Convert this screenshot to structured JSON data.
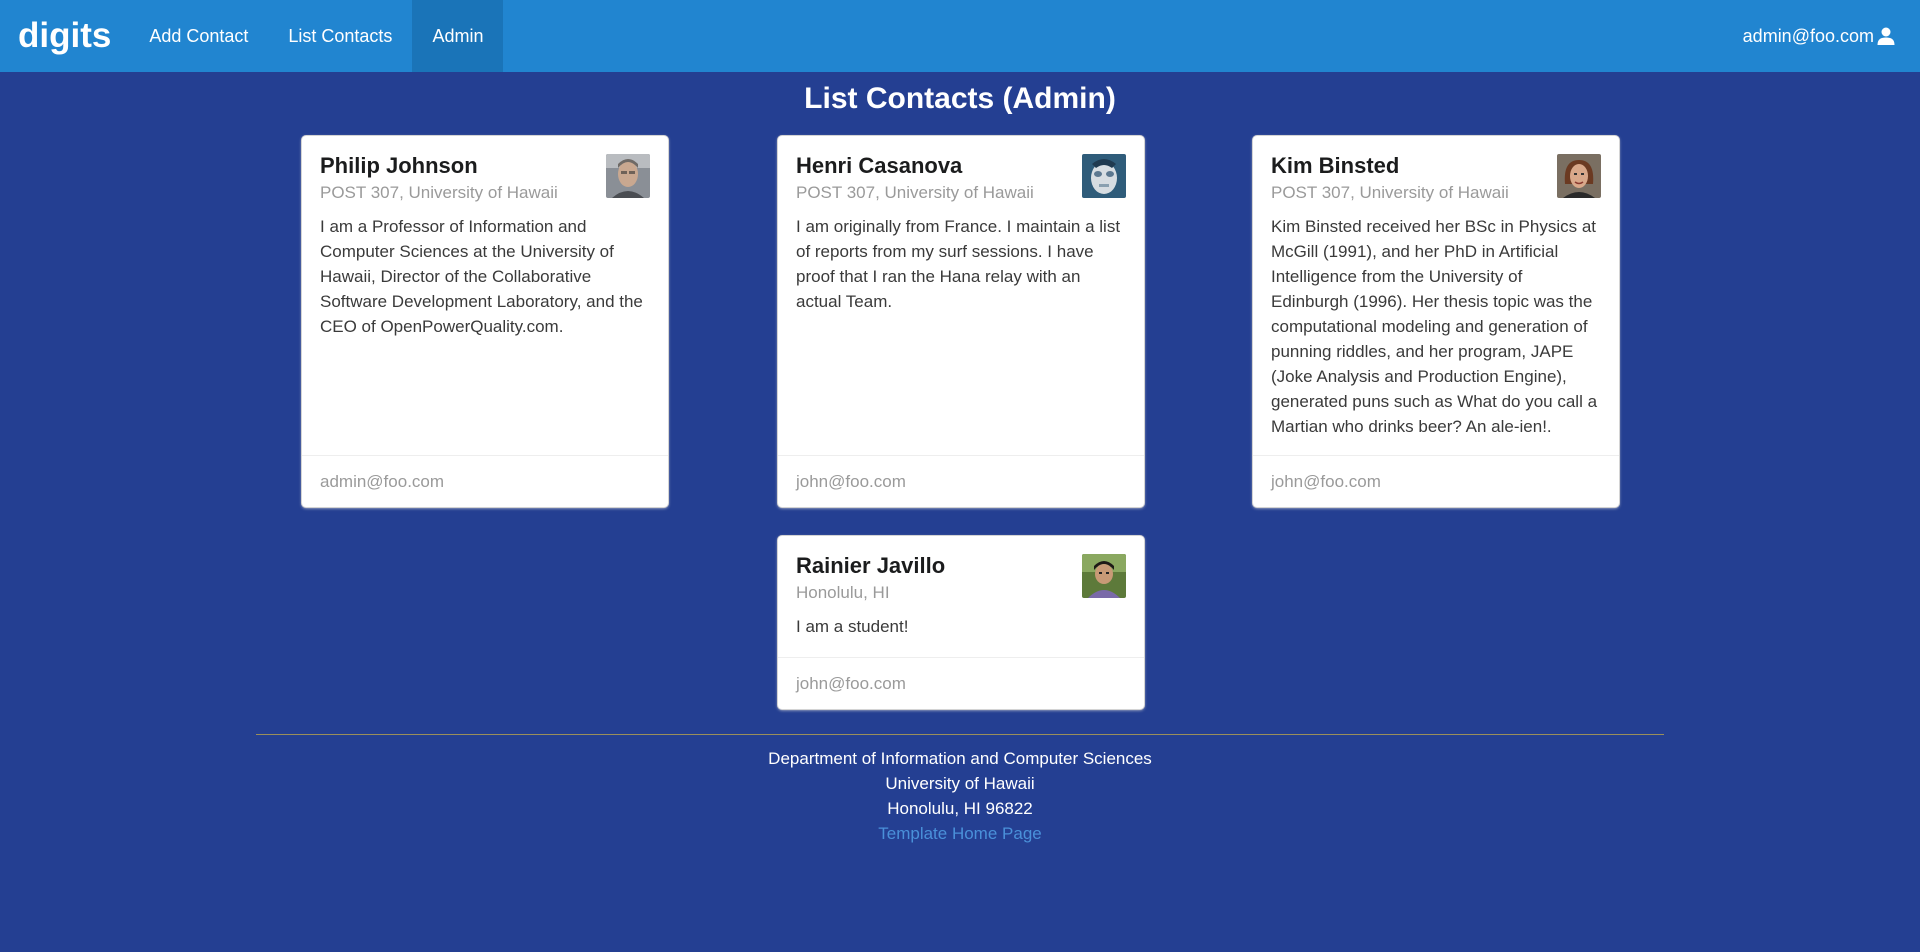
{
  "navbar": {
    "brand": "digits",
    "items": [
      {
        "label": "Add Contact"
      },
      {
        "label": "List Contacts"
      },
      {
        "label": "Admin",
        "active": true
      }
    ],
    "user": "admin@foo.com",
    "user_icon": "user-icon",
    "color": "#2185d0"
  },
  "page": {
    "title": "List Contacts (Admin)",
    "background": "#243f92"
  },
  "contacts": [
    {
      "name": "Philip Johnson",
      "address": "POST 307, University of Hawaii",
      "description": "I am a Professor of Information and Computer Sciences at the University of Hawaii, Director of the Collaborative Software Development Laboratory, and the CEO of OpenPowerQuality.com.",
      "owner": "admin@foo.com"
    },
    {
      "name": "Henri Casanova",
      "address": "POST 307, University of Hawaii",
      "description": "I am originally from France. I maintain a list of reports from my surf sessions. I have proof that I ran the Hana relay with an actual Team.",
      "owner": "john@foo.com"
    },
    {
      "name": "Kim Binsted",
      "address": "POST 307, University of Hawaii",
      "description": "Kim Binsted received her BSc in Physics at McGill (1991), and her PhD in Artificial Intelligence from the University of Edinburgh (1996). Her thesis topic was the computational modeling and generation of punning riddles, and her program, JAPE (Joke Analysis and Production Engine), generated puns such as What do you call a Martian who drinks beer? An ale-ien!.",
      "owner": "john@foo.com"
    },
    {
      "name": "Rainier Javillo",
      "address": "Honolulu, HI",
      "description": "I am a student!",
      "owner": "john@foo.com"
    }
  ],
  "footer": {
    "line1": "Department of Information and Computer Sciences",
    "line2": "University of Hawaii",
    "line3": "Honolulu, HI 96822",
    "link": "Template Home Page"
  }
}
